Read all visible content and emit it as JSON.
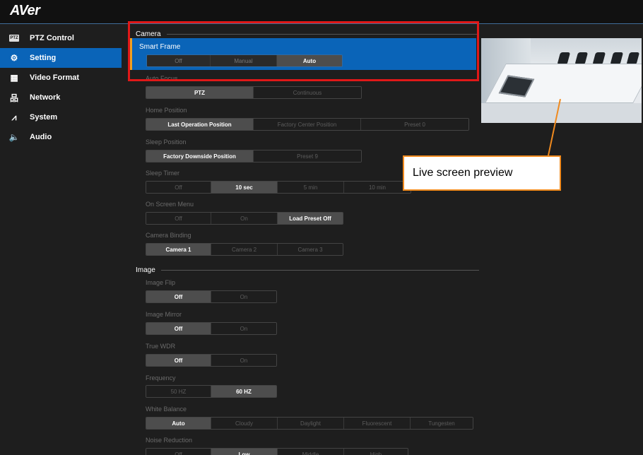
{
  "app": {
    "logo": "AVer"
  },
  "sidebar": {
    "items": [
      {
        "label": "PTZ Control",
        "icon": "ptz-icon",
        "badge": "PTZ",
        "active": false
      },
      {
        "label": "Setting",
        "icon": "gear-icon",
        "glyph": "⚙",
        "active": true
      },
      {
        "label": "Video Format",
        "icon": "film-icon",
        "glyph": "▦",
        "active": false
      },
      {
        "label": "Network",
        "icon": "network-icon",
        "glyph": "品",
        "active": false
      },
      {
        "label": "System",
        "icon": "pulse-icon",
        "glyph": "⩘",
        "active": false
      },
      {
        "label": "Audio",
        "icon": "speaker-icon",
        "glyph": "🔈",
        "active": false
      }
    ]
  },
  "camera": {
    "title": "Camera",
    "smart_frame": {
      "label": "Smart Frame",
      "options": [
        "Off",
        "Manual",
        "Auto"
      ],
      "selected": "Auto"
    },
    "auto_focus": {
      "label": "Auto Focus",
      "options": [
        "PTZ",
        "Continuous"
      ],
      "selected": "PTZ"
    },
    "home_position": {
      "label": "Home Position",
      "options": [
        "Last Operation Position",
        "Factory Center Position",
        "Preset 0"
      ],
      "selected": "Last Operation Position"
    },
    "sleep_position": {
      "label": "Sleep Position",
      "options": [
        "Factory Downside Position",
        "Preset 9"
      ],
      "selected": "Factory Downside Position"
    },
    "sleep_timer": {
      "label": "Sleep Timer",
      "options": [
        "Off",
        "10 sec",
        "5 min",
        "10 min"
      ],
      "selected": "10 sec"
    },
    "on_screen_menu": {
      "label": "On Screen Menu",
      "options": [
        "Off",
        "On",
        "Load Preset Off"
      ],
      "selected": "Load Preset Off"
    },
    "camera_binding": {
      "label": "Camera Binding",
      "options": [
        "Camera 1",
        "Camera 2",
        "Camera 3"
      ],
      "selected": "Camera 1"
    }
  },
  "image": {
    "title": "Image",
    "image_flip": {
      "label": "Image Flip",
      "options": [
        "Off",
        "On"
      ],
      "selected": "Off"
    },
    "image_mirror": {
      "label": "Image Mirror",
      "options": [
        "Off",
        "On"
      ],
      "selected": "Off"
    },
    "true_wdr": {
      "label": "True WDR",
      "options": [
        "Off",
        "On"
      ],
      "selected": "Off"
    },
    "frequency": {
      "label": "Frequency",
      "options": [
        "50 HZ",
        "60 HZ"
      ],
      "selected": "60 HZ"
    },
    "white_balance": {
      "label": "White Balance",
      "options": [
        "Auto",
        "Cloudy",
        "Daylight",
        "Fluorescent",
        "Tungesten"
      ],
      "selected": "Auto"
    },
    "noise_reduction": {
      "label": "Noise Reduction",
      "options": [
        "Off",
        "Low",
        "Middle",
        "High"
      ],
      "selected": "Low"
    }
  },
  "annotation": {
    "callout": "Live screen preview"
  },
  "colors": {
    "accent": "#0a64b8",
    "highlight_border": "#e01818",
    "callout_border": "#f08a1e",
    "background": "#1e1e1e"
  }
}
